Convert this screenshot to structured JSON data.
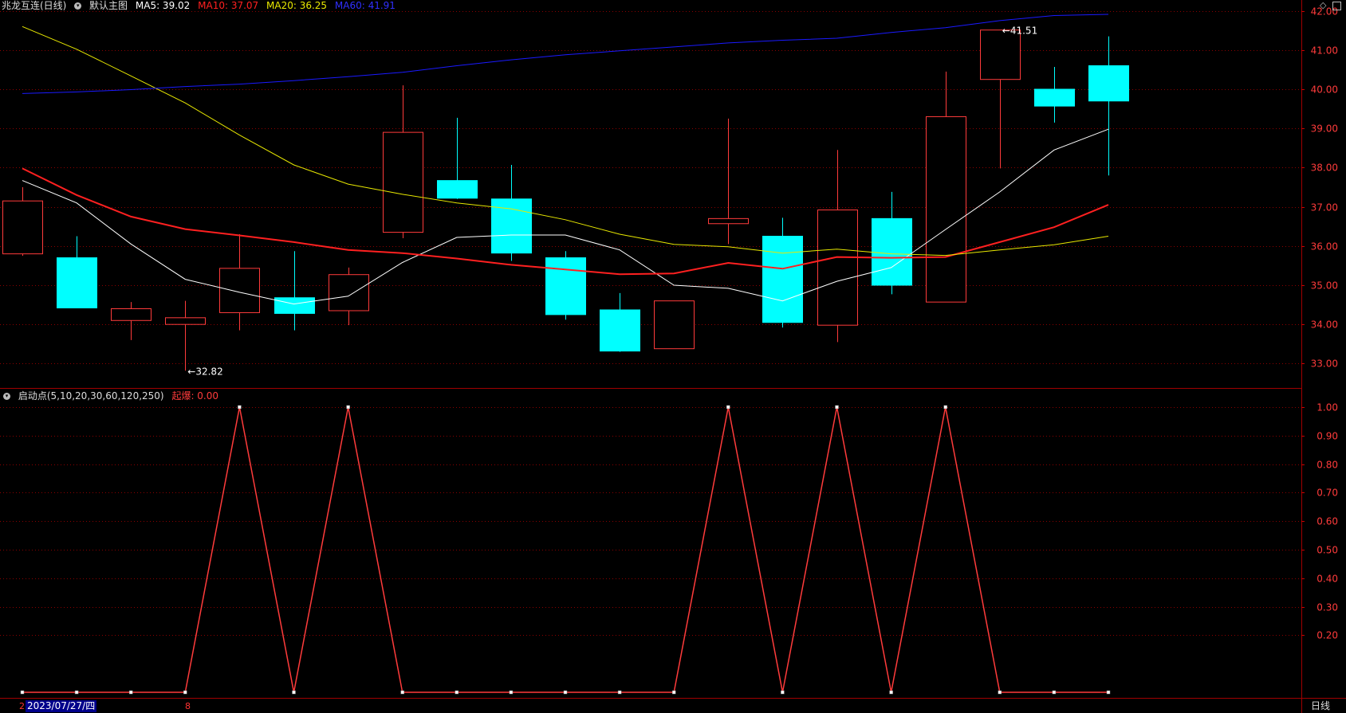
{
  "header": {
    "stock_title": "兆龙互连(日线)",
    "main_chart_label": "默认主图",
    "ma5": "MA5: 39.02",
    "ma10": "MA10: 37.07",
    "ma20": "MA20: 36.25",
    "ma60": "MA60: 41.91"
  },
  "indicator_header": {
    "name": "启动点(5,10,20,30,60,120,250)",
    "value": "起爆: 0.00"
  },
  "footer": {
    "left_mark": "2",
    "date": "2023/07/27/四",
    "mid_mark": "8",
    "period": "日线"
  },
  "colors": {
    "up": "#ff3b3b",
    "down": "#00ffff",
    "ma5": "#ffffff",
    "ma10": "#ff2020",
    "ma20": "#e8e800",
    "ma60": "#1a1aff",
    "grid": "#8b0000",
    "axis_text": "#ff3b3b"
  },
  "icons": {
    "diamond": "◇",
    "window": "window-icon"
  },
  "chart_data": [
    {
      "type": "candlestick",
      "title": "",
      "ylim": [
        32.4,
        42.0
      ],
      "yticks": [
        "42.00",
        "41.00",
        "40.00",
        "39.00",
        "38.00",
        "37.00",
        "36.00",
        "35.00",
        "34.00",
        "33.00"
      ],
      "candles": [
        {
          "o": 35.8,
          "h": 37.5,
          "l": 35.75,
          "c": 37.15
        },
        {
          "o": 35.7,
          "h": 36.25,
          "l": 34.42,
          "c": 34.42
        },
        {
          "o": 34.1,
          "h": 34.57,
          "l": 33.6,
          "c": 34.4
        },
        {
          "o": 34.0,
          "h": 34.6,
          "l": 32.82,
          "c": 34.17
        },
        {
          "o": 34.3,
          "h": 36.3,
          "l": 33.85,
          "c": 35.43
        },
        {
          "o": 34.68,
          "h": 35.87,
          "l": 33.85,
          "c": 34.28
        },
        {
          "o": 34.35,
          "h": 35.45,
          "l": 33.98,
          "c": 35.27
        },
        {
          "o": 36.35,
          "h": 40.1,
          "l": 36.2,
          "c": 38.9
        },
        {
          "o": 37.67,
          "h": 39.27,
          "l": 37.2,
          "c": 37.22
        },
        {
          "o": 37.2,
          "h": 38.07,
          "l": 35.62,
          "c": 35.82
        },
        {
          "o": 35.7,
          "h": 35.87,
          "l": 34.12,
          "c": 34.25
        },
        {
          "o": 34.37,
          "h": 34.8,
          "l": 33.3,
          "c": 33.32
        },
        {
          "o": 33.38,
          "h": 34.6,
          "l": 33.38,
          "c": 34.6
        },
        {
          "o": 36.57,
          "h": 39.25,
          "l": 36.05,
          "c": 36.7
        },
        {
          "o": 36.25,
          "h": 36.72,
          "l": 33.92,
          "c": 34.05
        },
        {
          "o": 33.98,
          "h": 38.45,
          "l": 33.55,
          "c": 36.92
        },
        {
          "o": 36.7,
          "h": 37.38,
          "l": 34.77,
          "c": 35.0
        },
        {
          "o": 34.57,
          "h": 40.45,
          "l": 34.57,
          "c": 39.3
        },
        {
          "o": 40.25,
          "h": 41.51,
          "l": 37.98,
          "c": 41.51
        },
        {
          "o": 40.0,
          "h": 40.57,
          "l": 39.15,
          "c": 39.57
        },
        {
          "o": 40.6,
          "h": 41.35,
          "l": 37.8,
          "c": 39.7
        }
      ],
      "series": [
        {
          "name": "MA5",
          "values": [
            37.67,
            37.1,
            36.05,
            35.15,
            34.82,
            34.52,
            34.72,
            35.58,
            36.22,
            36.28,
            36.28,
            35.9,
            35.0,
            34.92,
            34.6,
            35.1,
            35.45,
            36.42,
            37.38,
            38.45,
            38.98
          ]
        },
        {
          "name": "MA10",
          "values": [
            37.98,
            37.3,
            36.75,
            36.43,
            36.27,
            36.1,
            35.9,
            35.82,
            35.68,
            35.52,
            35.4,
            35.28,
            35.3,
            35.57,
            35.42,
            35.72,
            35.7,
            35.72,
            36.1,
            36.48,
            37.05
          ]
        },
        {
          "name": "MA20",
          "values": [
            41.6,
            41.02,
            40.34,
            39.65,
            38.83,
            38.07,
            37.58,
            37.32,
            37.1,
            36.95,
            36.67,
            36.3,
            36.04,
            35.98,
            35.82,
            35.92,
            35.8,
            35.76,
            35.9,
            36.03,
            36.25
          ]
        },
        {
          "name": "MA60",
          "values": [
            39.89,
            39.93,
            39.99,
            40.07,
            40.13,
            40.22,
            40.32,
            40.43,
            40.6,
            40.75,
            40.88,
            40.98,
            41.08,
            41.18,
            41.25,
            41.3,
            41.45,
            41.57,
            41.75,
            41.88,
            41.91
          ]
        }
      ],
      "annotations": [
        {
          "label": "41.51",
          "index": 18,
          "value": 41.51,
          "kind": "high"
        },
        {
          "label": "32.82",
          "index": 3,
          "value": 32.82,
          "kind": "low"
        }
      ]
    },
    {
      "type": "line",
      "title": "",
      "ylim": [
        0,
        1.05
      ],
      "yticks": [
        "1.00",
        "0.90",
        "0.80",
        "0.70",
        "0.60",
        "0.50",
        "0.40",
        "0.30",
        "0.20"
      ],
      "series": [
        {
          "name": "",
          "values": [
            0,
            0,
            0,
            0,
            1,
            0,
            1,
            0,
            0,
            0,
            0,
            0,
            0,
            1,
            0,
            1,
            0,
            1,
            0,
            0,
            0
          ]
        }
      ]
    }
  ]
}
